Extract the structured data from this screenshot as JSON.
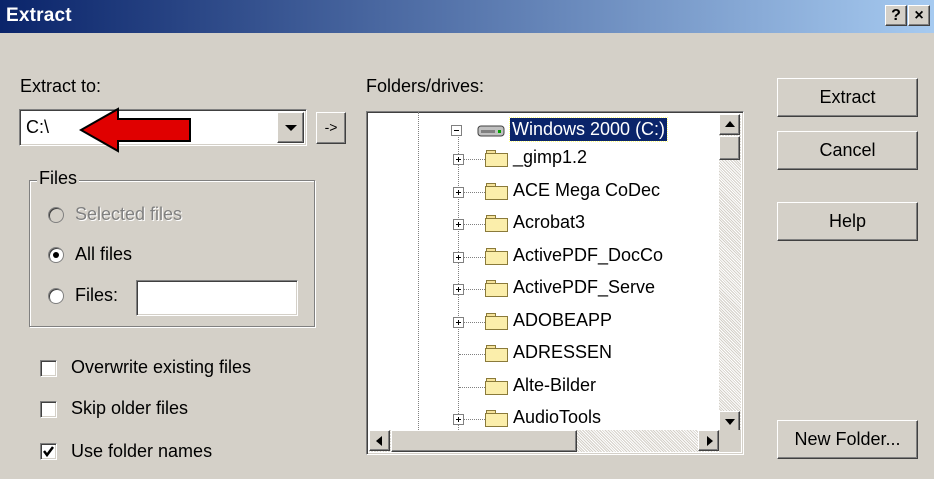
{
  "window": {
    "title": "Extract",
    "help_label": "?",
    "close_label": "×"
  },
  "extract_to": {
    "label": "Extract to:",
    "value": "C:\\",
    "go_label": "->"
  },
  "files_group": {
    "title": "Files",
    "selected_label": "Selected files",
    "all_label": "All files",
    "files_label": "Files:",
    "files_value": "",
    "selected_option": "All files"
  },
  "options": {
    "overwrite_label": "Overwrite existing files",
    "overwrite_checked": false,
    "skip_label": "Skip older files",
    "skip_checked": false,
    "folder_names_label": "Use folder names",
    "folder_names_checked": true
  },
  "folders": {
    "label": "Folders/drives:",
    "root": "Windows 2000 (C:)",
    "items": [
      {
        "name": "_gimp1.2",
        "expandable": true
      },
      {
        "name": "ACE Mega CoDec",
        "expandable": true
      },
      {
        "name": "Acrobat3",
        "expandable": true
      },
      {
        "name": "ActivePDF_DocCo",
        "expandable": true
      },
      {
        "name": "ActivePDF_Serve",
        "expandable": true
      },
      {
        "name": "ADOBEAPP",
        "expandable": true
      },
      {
        "name": "ADRESSEN",
        "expandable": false
      },
      {
        "name": "Alte-Bilder",
        "expandable": false
      },
      {
        "name": "AudioTools",
        "expandable": true
      }
    ]
  },
  "buttons": {
    "extract": "Extract",
    "cancel": "Cancel",
    "help": "Help",
    "new_folder": "New Folder..."
  },
  "colors": {
    "title_start": "#0a246a",
    "title_end": "#a6caf0",
    "face": "#d4d0c8",
    "selection": "#0a246a",
    "arrow": "#e00000"
  }
}
